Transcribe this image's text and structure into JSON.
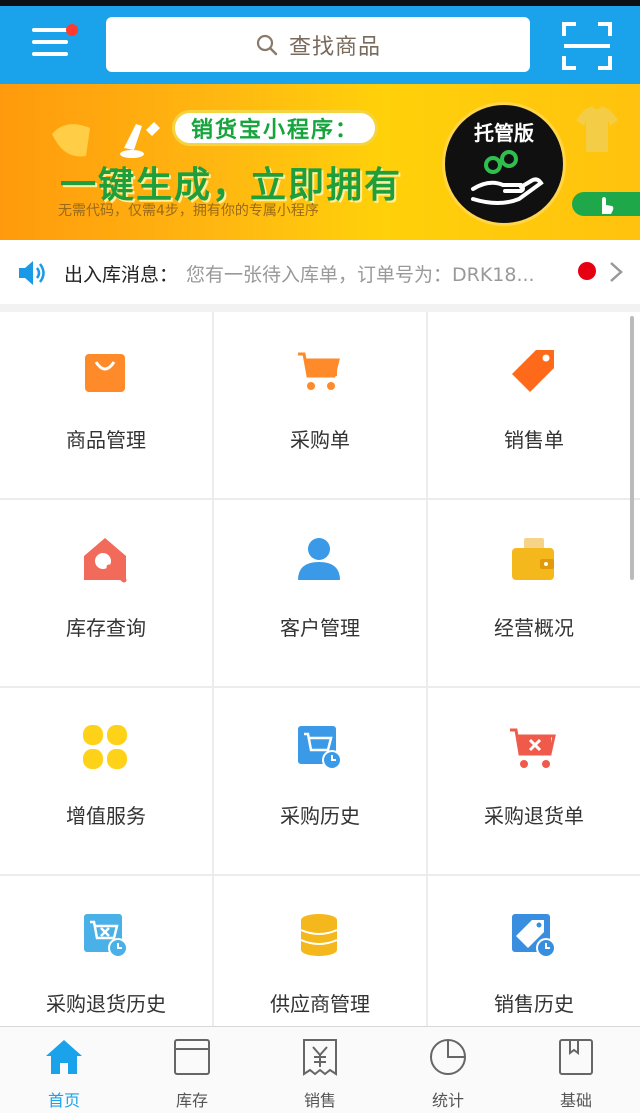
{
  "header": {
    "search_placeholder": "查找商品"
  },
  "banner": {
    "pill": "销货宝小程序：",
    "headline": "一键生成，立即拥有",
    "subline": "无需代码，仅需4步，拥有你的专属小程序",
    "badge": "托管版"
  },
  "notice": {
    "label": "出入库消息：",
    "message": "您有一张待入库单，订单号为：DRK18..."
  },
  "grid": [
    {
      "label": "商品管理",
      "icon": "bag-icon",
      "color": "#ff8a2a"
    },
    {
      "label": "采购单",
      "icon": "cart-icon",
      "color": "#ff8a2a"
    },
    {
      "label": "销售单",
      "icon": "tag-icon",
      "color": "#ff6a1a"
    },
    {
      "label": "库存查询",
      "icon": "house-search-icon",
      "color": "#f26b5a"
    },
    {
      "label": "客户管理",
      "icon": "person-icon",
      "color": "#3a9ae8"
    },
    {
      "label": "经营概况",
      "icon": "wallet-icon",
      "color": "#f5b81c"
    },
    {
      "label": "增值服务",
      "icon": "clover-icon",
      "color": "#ffd21a"
    },
    {
      "label": "采购历史",
      "icon": "cart-history-icon",
      "color": "#3a9ae8"
    },
    {
      "label": "采购退货单",
      "icon": "cart-cancel-icon",
      "color": "#f05a4a"
    },
    {
      "label": "采购退货历史",
      "icon": "return-history-icon",
      "color": "#4ab0e8"
    },
    {
      "label": "供应商管理",
      "icon": "coins-icon",
      "color": "#f5b81c"
    },
    {
      "label": "销售历史",
      "icon": "tag-history-icon",
      "color": "#3a8ee0"
    }
  ],
  "tabs": [
    {
      "label": "首页",
      "icon": "home-icon"
    },
    {
      "label": "库存",
      "icon": "box-icon"
    },
    {
      "label": "销售",
      "icon": "receipt-icon"
    },
    {
      "label": "统计",
      "icon": "pie-icon"
    },
    {
      "label": "基础",
      "icon": "book-icon"
    }
  ],
  "colors": {
    "primary": "#1aa3ea",
    "notice_dot": "#e60012"
  }
}
